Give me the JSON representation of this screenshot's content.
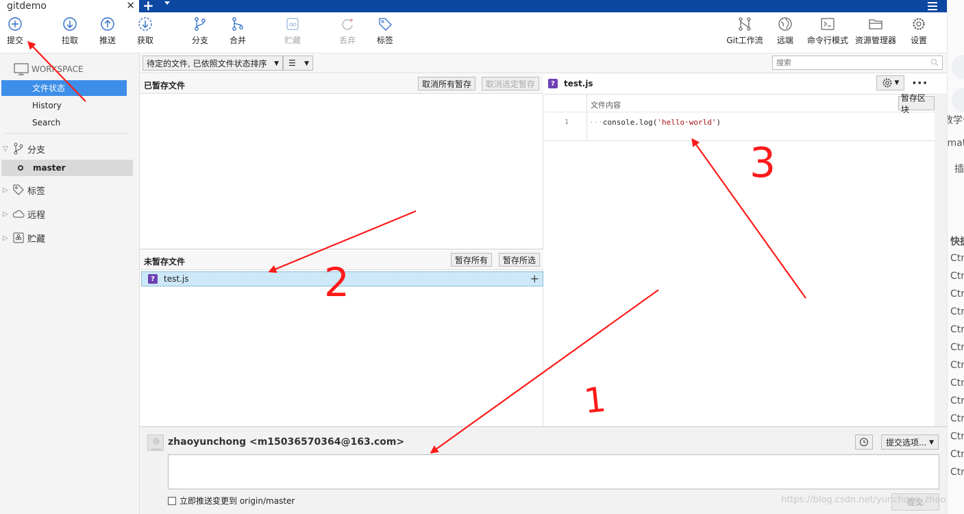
{
  "window": {
    "tab_title": "gitdemo",
    "close_glyph": "✕",
    "add_glyph": "+"
  },
  "toolbar": {
    "commit": "提交",
    "pull": "拉取",
    "push": "推送",
    "fetch": "获取",
    "branch": "分支",
    "merge": "合并",
    "stash": "贮藏",
    "discard": "丢弃",
    "tag": "标签",
    "git_flow": "Git工作流",
    "remote": "远端",
    "terminal": "命令行模式",
    "explorer": "资源管理器",
    "settings": "设置"
  },
  "sidebar": {
    "workspace": "WORKSPACE",
    "items": [
      {
        "label": "文件状态",
        "selected": true
      },
      {
        "label": "History"
      },
      {
        "label": "Search"
      }
    ],
    "branches": "分支",
    "current_branch": "master",
    "tags": "标签",
    "remotes": "远程",
    "stashes": "贮藏"
  },
  "filter": {
    "sort_label": "待定的文件, 已依照文件状态排序",
    "view_glyph": "☰",
    "search_placeholder": "搜索"
  },
  "staged": {
    "title": "已暂存文件",
    "unstage_all": "取消所有暂存",
    "unstage_selected": "取消选定暂存"
  },
  "unstaged": {
    "title": "未暂存文件",
    "stage_all": "暂存所有",
    "stage_selected": "暂存所选",
    "files": [
      {
        "name": "test.js",
        "status_glyph": "?"
      }
    ]
  },
  "diff": {
    "file": "test.js",
    "status_glyph": "?",
    "hunk_label": "文件内容",
    "stage_hunk": "暂存区块",
    "line_number": "1",
    "line_prefix": "···",
    "line_fn": "console.log(",
    "line_str": "'hello·world'",
    "line_suffix": ")"
  },
  "commit": {
    "author": "zhaoyunchong <m15036570364@163.com>",
    "options": "提交选项...",
    "push_label": "立即推送变更到 origin/master",
    "submit": "提交"
  },
  "right_strip": {
    "t1": "教学公",
    "t2": "rmat",
    "t3": "插",
    "t4": "快捷",
    "ctrl": "Ctrl"
  },
  "watermark": "https://blog.csdn.net/yunchong_zhao",
  "annotations": {
    "n1": "1",
    "n2": "2",
    "n3": "3"
  },
  "colors": {
    "accent": "#3d8ee8",
    "titlebar": "#0c47a1",
    "annotation": "#ff1a1a",
    "untracked": "#6e3fb5"
  }
}
